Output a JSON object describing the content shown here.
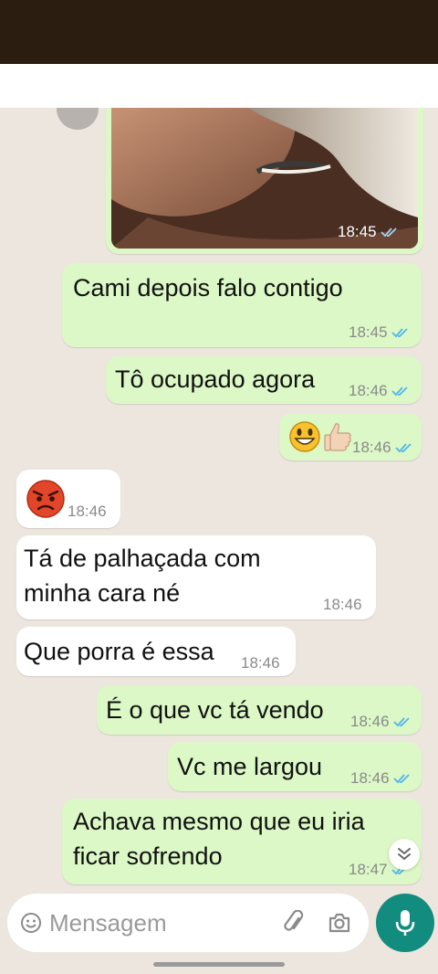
{
  "messages": [
    {
      "id": "m1",
      "direction": "out",
      "text": "Cami depois falo contigo",
      "time": "18:45",
      "read": true
    },
    {
      "id": "m2",
      "direction": "out",
      "text": "Tô ocupado agora",
      "time": "18:46",
      "read": true
    },
    {
      "id": "m3",
      "direction": "out",
      "text": "",
      "emoji": [
        "grinning-face-emoji",
        "thumbs-up-emoji"
      ],
      "time": "18:46",
      "read": true
    },
    {
      "id": "m4",
      "direction": "in",
      "text": "",
      "emoji": [
        "angry-face-emoji"
      ],
      "time": "18:46"
    },
    {
      "id": "m5",
      "direction": "in",
      "text": "Tá de palhaçada com",
      "text2": "minha cara né",
      "time": "18:46"
    },
    {
      "id": "m6",
      "direction": "in",
      "text": "Que porra é essa",
      "time": "18:46"
    },
    {
      "id": "m7",
      "direction": "out",
      "text": "É o que vc tá vendo",
      "time": "18:46",
      "read": true
    },
    {
      "id": "m8",
      "direction": "out",
      "text": "Vc me largou",
      "time": "18:46",
      "read": true
    },
    {
      "id": "m9",
      "direction": "out",
      "text": "Achava mesmo que eu iria",
      "text2": "ficar sofrendo",
      "time": "18:47",
      "read": true
    }
  ],
  "photo_message": {
    "time": "18:45",
    "read": true
  },
  "composer": {
    "placeholder": "Mensagem"
  },
  "colors": {
    "outgoing_bubble": "#dcf8c6",
    "incoming_bubble": "#ffffff",
    "chat_background": "#ece6df",
    "read_ticks": "#4fb6ec",
    "mic_button": "#128c7e",
    "status_bar": "#2b1d10"
  },
  "icons": [
    "emoji-icon",
    "attach-icon",
    "camera-icon",
    "mic-icon",
    "double-check-icon",
    "chevron-double-down-icon"
  ]
}
